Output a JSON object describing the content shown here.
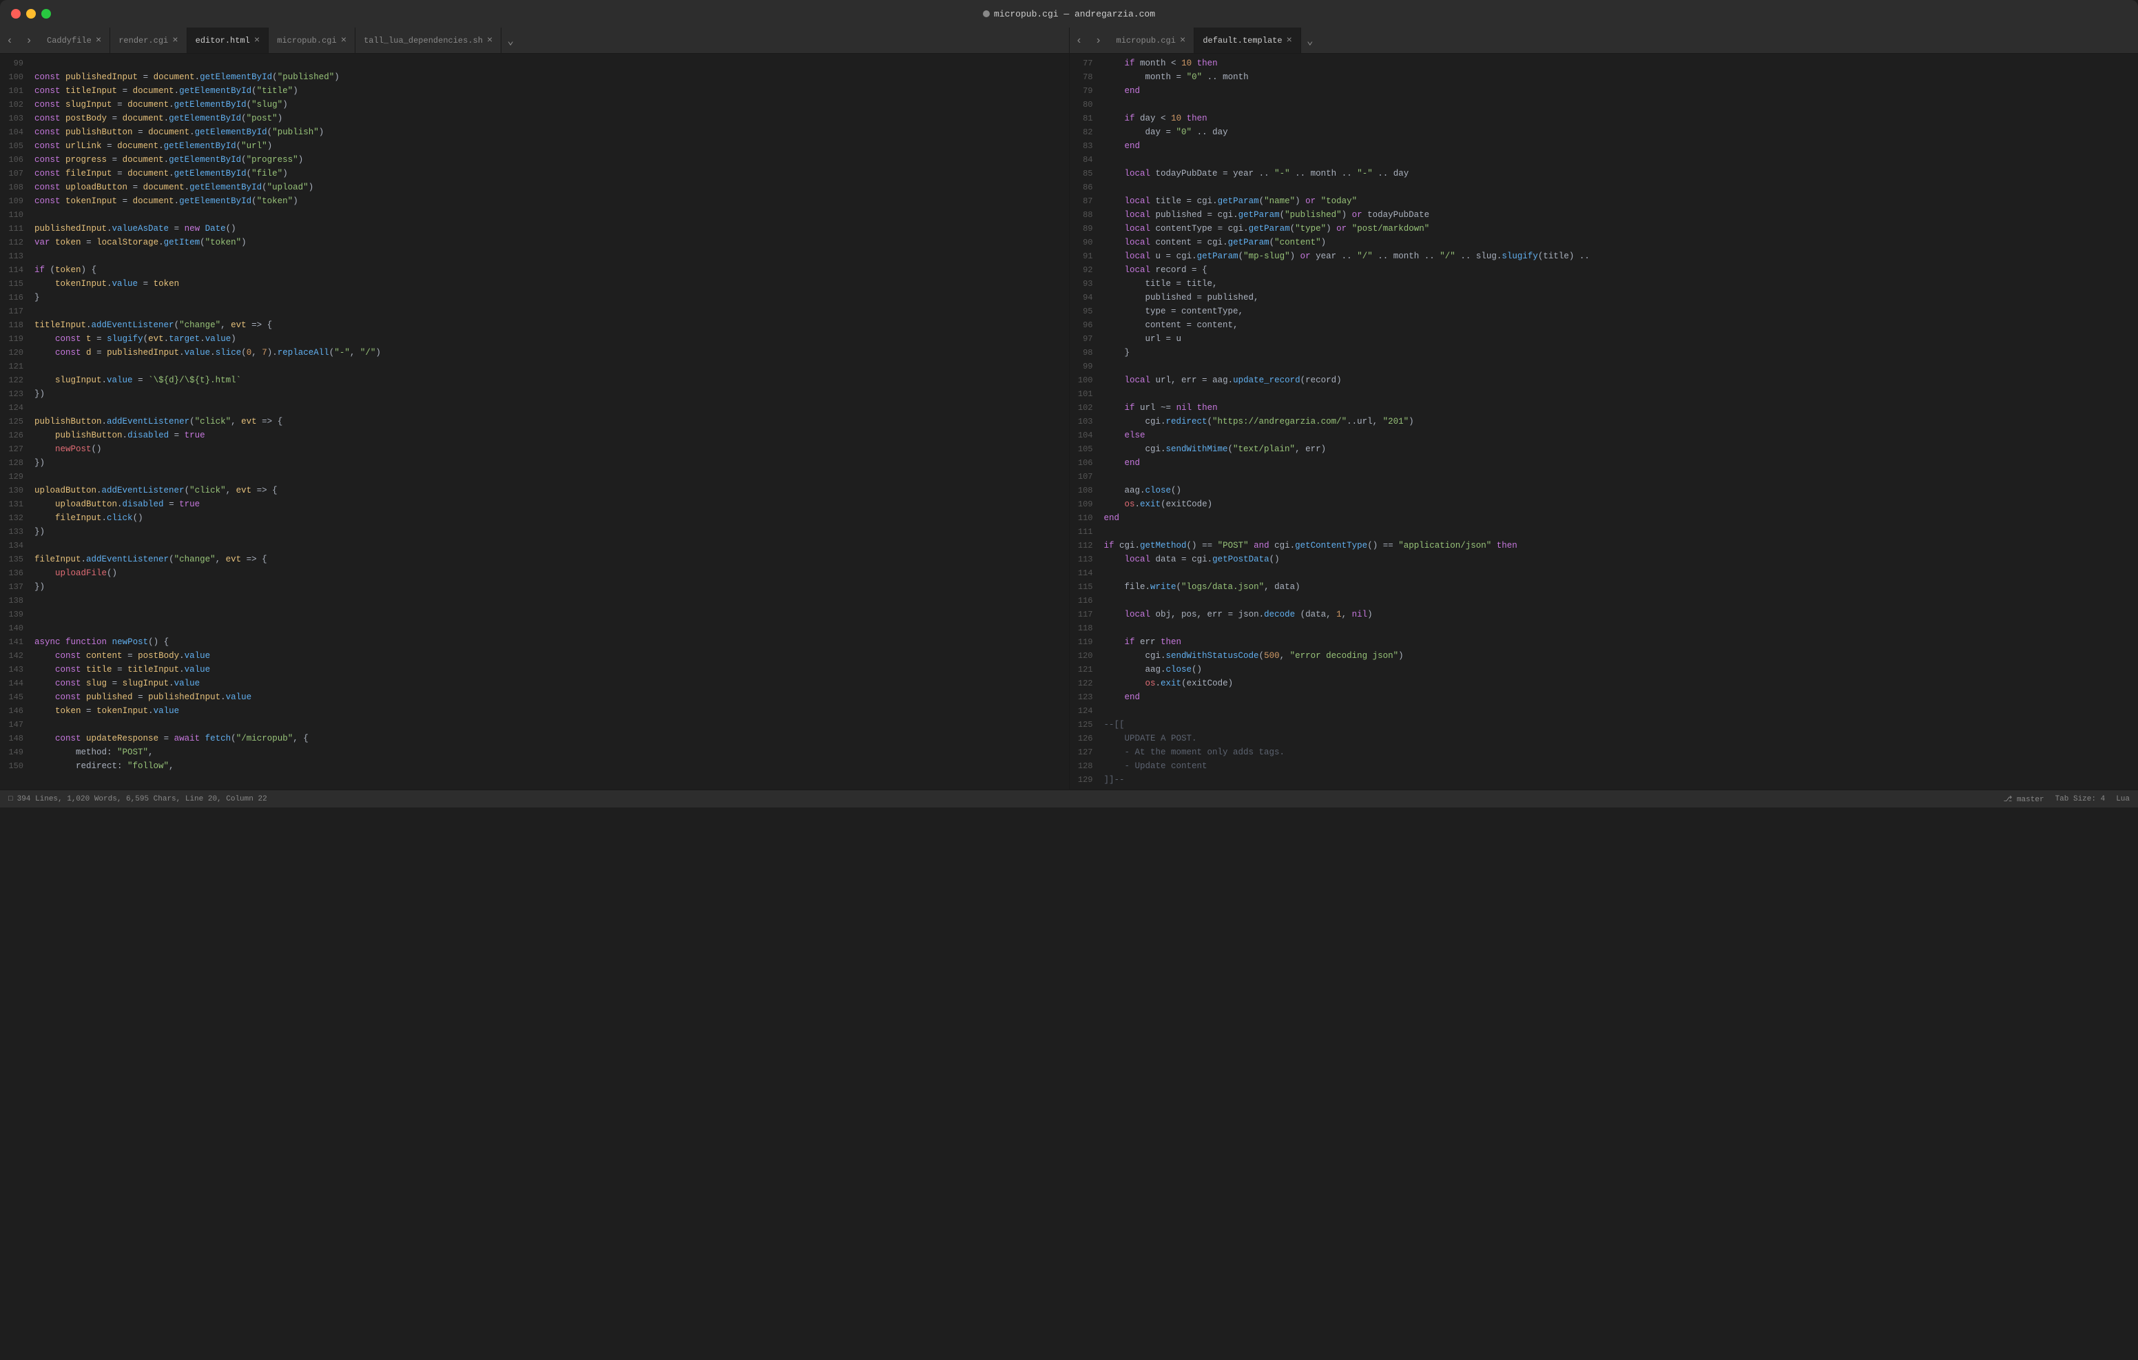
{
  "window": {
    "title": "micropub.cgi — andregarzia.com",
    "traffic_lights": [
      "close",
      "minimize",
      "maximize"
    ]
  },
  "tabs_left": {
    "items": [
      {
        "label": "Caddyfile",
        "active": false,
        "closable": true
      },
      {
        "label": "render.cgi",
        "active": false,
        "closable": true
      },
      {
        "label": "editor.html",
        "active": false,
        "closable": true
      },
      {
        "label": "micropub.cgi",
        "active": false,
        "closable": true
      },
      {
        "label": "tall_lua_dependencies.sh",
        "active": false,
        "closable": true
      }
    ]
  },
  "tabs_right": {
    "items": [
      {
        "label": "micropub.cgi",
        "active": false,
        "closable": true
      },
      {
        "label": "default.template",
        "active": false,
        "closable": true
      }
    ]
  },
  "status_bar": {
    "file_icon": "□",
    "stats": "394 Lines, 1,020 Words, 6,595 Chars, Line 20, Column 22",
    "branch_icon": "⎇",
    "branch": "master",
    "tab_size": "Tab Size: 4",
    "language": "Lua"
  },
  "left_pane": {
    "lines": [
      {
        "num": "99",
        "code": ""
      },
      {
        "num": "100",
        "code": "<kw>const</kw> <id>publishedInput</id> <op>=</op> <id>document</id>.<fn>getElementById</fn>(<str>\"published\"</str>)"
      },
      {
        "num": "101",
        "code": "<kw>const</kw> <id>titleInput</id> <op>=</op> <id>document</id>.<fn>getElementById</fn>(<str>\"title\"</str>)"
      },
      {
        "num": "102",
        "code": "<kw>const</kw> <id>slugInput</id> <op>=</op> <id>document</id>.<fn>getElementById</fn>(<str>\"slug\"</str>)"
      },
      {
        "num": "103",
        "code": "<kw>const</kw> <id>postBody</id> <op>=</op> <id>document</id>.<fn>getElementById</fn>(<str>\"post\"</str>)"
      },
      {
        "num": "104",
        "code": "<kw>const</kw> <id>publishButton</id> <op>=</op> <id>document</id>.<fn>getElementById</fn>(<str>\"publish\"</str>)"
      },
      {
        "num": "105",
        "code": "<kw>const</kw> <id>urlLink</id> <op>=</op> <id>document</id>.<fn>getElementById</fn>(<str>\"url\"</str>)"
      },
      {
        "num": "106",
        "code": "<kw>const</kw> <id>progress</id> <op>=</op> <id>document</id>.<fn>getElementById</fn>(<str>\"progress\"</str>)"
      },
      {
        "num": "107",
        "code": "<kw>const</kw> <id>fileInput</id> <op>=</op> <id>document</id>.<fn>getElementById</fn>(<str>\"file\"</str>)"
      },
      {
        "num": "108",
        "code": "<kw>const</kw> <id>uploadButton</id> <op>=</op> <id>document</id>.<fn>getElementById</fn>(<str>\"upload\"</str>)"
      },
      {
        "num": "109",
        "code": "<kw>const</kw> <id>tokenInput</id> <op>=</op> <id>document</id>.<fn>getElementById</fn>(<str>\"token\"</str>)"
      },
      {
        "num": "110",
        "code": ""
      },
      {
        "num": "111",
        "code": "<id>publishedInput</id>.<prop>valueAsDate</prop> <op>=</op> <kw>new</kw> <fn>Date</fn>()"
      },
      {
        "num": "112",
        "code": "<kw>var</kw> <id>token</id> <op>=</op> <id>localStorage</id>.<fn>getItem</fn>(<str>\"token\"</str>)"
      },
      {
        "num": "113",
        "code": ""
      },
      {
        "num": "114",
        "code": "<kw>if</kw> (<id>token</id>) <punc>{</punc>"
      },
      {
        "num": "115",
        "code": "    <id>tokenInput</id>.<prop>value</prop> <op>=</op> <id>token</id>"
      },
      {
        "num": "116",
        "code": "<punc>}</punc>"
      },
      {
        "num": "117",
        "code": ""
      },
      {
        "num": "118",
        "code": "<id>titleInput</id>.<fn>addEventListener</fn>(<str>\"change\"</str>, <id>evt</id> <op>=></op> <punc>{</punc>"
      },
      {
        "num": "119",
        "code": "    <kw>const</kw> <id>t</id> <op>=</op> <fn>slugify</fn>(<id>evt</id>.<prop>target</prop>.<prop>value</prop>)"
      },
      {
        "num": "120",
        "code": "    <kw>const</kw> <id>d</id> <op>=</op> <id>publishedInput</id>.<prop>value</prop>.<fn>slice</fn>(<num>0</num>, <num>7</num>).<fn>replaceAll</fn>(<str>\"-\"</str>, <str>\"/\"</str>)"
      },
      {
        "num": "121",
        "code": ""
      },
      {
        "num": "122",
        "code": "    <id>slugInput</id>.<prop>value</prop> <op>=</op> <str>`\\${d}/\\${t}.html`</str>"
      },
      {
        "num": "123",
        "code": "<punc>})</punc>"
      },
      {
        "num": "124",
        "code": ""
      },
      {
        "num": "125",
        "code": "<id>publishButton</id>.<fn>addEventListener</fn>(<str>\"click\"</str>, <id>evt</id> <op>=></op> <punc>{</punc>"
      },
      {
        "num": "126",
        "code": "    <id>publishButton</id>.<prop>disabled</prop> <op>=</op> <kw>true</kw>"
      },
      {
        "num": "127",
        "code": "    <red>newPost</red>()"
      },
      {
        "num": "128",
        "code": "<punc>})</punc>"
      },
      {
        "num": "129",
        "code": ""
      },
      {
        "num": "130",
        "code": "<id>uploadButton</id>.<fn>addEventListener</fn>(<str>\"click\"</str>, <id>evt</id> <op>=></op> <punc>{</punc>"
      },
      {
        "num": "131",
        "code": "    <id>uploadButton</id>.<prop>disabled</prop> <op>=</op> <kw>true</kw>"
      },
      {
        "num": "132",
        "code": "    <id>fileInput</id>.<fn>click</fn>()"
      },
      {
        "num": "133",
        "code": "<punc>})</punc>"
      },
      {
        "num": "134",
        "code": ""
      },
      {
        "num": "135",
        "code": "<id>fileInput</id>.<fn>addEventListener</fn>(<str>\"change\"</str>, <id>evt</id> <op>=></op> <punc>{</punc>"
      },
      {
        "num": "136",
        "code": "    <red>uploadFile</red>()"
      },
      {
        "num": "137",
        "code": "<punc>})</punc>"
      },
      {
        "num": "138",
        "code": ""
      },
      {
        "num": "139",
        "code": ""
      },
      {
        "num": "140",
        "code": ""
      },
      {
        "num": "141",
        "code": "<kw>async</kw> <kw>function</kw> <fn>newPost</fn>() <punc>{</punc>"
      },
      {
        "num": "142",
        "code": "    <kw>const</kw> <id>content</id> <op>=</op> <id>postBody</id>.<prop>value</prop>"
      },
      {
        "num": "143",
        "code": "    <kw>const</kw> <id>title</id> <op>=</op> <id>titleInput</id>.<prop>value</prop>"
      },
      {
        "num": "144",
        "code": "    <kw>const</kw> <id>slug</id> <op>=</op> <id>slugInput</id>.<prop>value</prop>"
      },
      {
        "num": "145",
        "code": "    <kw>const</kw> <id>published</id> <op>=</op> <id>publishedInput</id>.<prop>value</prop>"
      },
      {
        "num": "146",
        "code": "    <id>token</id> <op>=</op> <id>tokenInput</id>.<prop>value</prop>"
      },
      {
        "num": "147",
        "code": ""
      },
      {
        "num": "148",
        "code": "    <kw>const</kw> <id>updateResponse</id> <op>=</op> <kw>await</kw> <fn>fetch</fn>(<str>\"/micropub\"</str>, <punc>{</punc>"
      },
      {
        "num": "149",
        "code": "        method: <str>\"POST\"</str>,"
      },
      {
        "num": "150",
        "code": "        redirect: <str>\"follow\"</str>,"
      }
    ]
  },
  "right_pane": {
    "lines": [
      {
        "num": "77",
        "code": "    <kw>if</kw> month <op>&lt;</op> <num>10</num> <kw>then</kw>"
      },
      {
        "num": "78",
        "code": "        month <op>=</op> <str>\"0\"</str> <op>..</op> month"
      },
      {
        "num": "79",
        "code": "    <kw>end</kw>"
      },
      {
        "num": "80",
        "code": ""
      },
      {
        "num": "81",
        "code": "    <kw>if</kw> day <op>&lt;</op> <num>10</num> <kw>then</kw>"
      },
      {
        "num": "82",
        "code": "        day <op>=</op> <str>\"0\"</str> <op>..</op> day"
      },
      {
        "num": "83",
        "code": "    <kw>end</kw>"
      },
      {
        "num": "84",
        "code": ""
      },
      {
        "num": "85",
        "code": "    <kw>local</kw> todayPubDate <op>=</op> year <op>..</op> <str>\"-\"</str> <op>..</op> month <op>..</op> <str>\"-\"</str> <op>..</op> day"
      },
      {
        "num": "86",
        "code": ""
      },
      {
        "num": "87",
        "code": "    <kw>local</kw> title <op>=</op> cgi.<fn>getParam</fn>(<str>\"name\"</str>) <kw>or</kw> <str>\"today\"</str>"
      },
      {
        "num": "88",
        "code": "    <kw>local</kw> published <op>=</op> cgi.<fn>getParam</fn>(<str>\"published\"</str>) <kw>or</kw> todayPubDate"
      },
      {
        "num": "89",
        "code": "    <kw>local</kw> contentType <op>=</op> cgi.<fn>getParam</fn>(<str>\"type\"</str>) <kw>or</kw> <str>\"post/markdown\"</str>"
      },
      {
        "num": "90",
        "code": "    <kw>local</kw> content <op>=</op> cgi.<fn>getParam</fn>(<str>\"content\"</str>)"
      },
      {
        "num": "91",
        "code": "    <kw>local</kw> u <op>=</op> cgi.<fn>getParam</fn>(<str>\"mp-slug\"</str>) <kw>or</kw> year <op>..</op> <str>\"/\"</str> <op>..</op> month <op>..</op> <str>\"/\"</str> <op>..</op> slug.<fn>slugify</fn>(title) <op>..</op>"
      },
      {
        "num": "92",
        "code": "    <kw>local</kw> record <op>=</op> <punc>{</punc>"
      },
      {
        "num": "93",
        "code": "        title <op>=</op> title,"
      },
      {
        "num": "94",
        "code": "        published <op>=</op> published,"
      },
      {
        "num": "95",
        "code": "        type <op>=</op> contentType,"
      },
      {
        "num": "96",
        "code": "        content <op>=</op> content,"
      },
      {
        "num": "97",
        "code": "        url <op>=</op> u"
      },
      {
        "num": "98",
        "code": "    <punc>}</punc>"
      },
      {
        "num": "99",
        "code": ""
      },
      {
        "num": "100",
        "code": "    <kw>local</kw> url, err <op>=</op> aag.<fn>update_record</fn>(record)"
      },
      {
        "num": "101",
        "code": ""
      },
      {
        "num": "102",
        "code": "    <kw>if</kw> url <op>~=</op> <kw>nil</kw> <kw>then</kw>"
      },
      {
        "num": "103",
        "code": "        cgi.<fn>redirect</fn>(<str>\"https://andregarzia.com/\"</str><op>..</op>url, <str>\"201\"</str>)"
      },
      {
        "num": "104",
        "code": "    <kw>else</kw>"
      },
      {
        "num": "105",
        "code": "        cgi.<fn>sendWithMime</fn>(<str>\"text/plain\"</str>, err)"
      },
      {
        "num": "106",
        "code": "    <kw>end</kw>"
      },
      {
        "num": "107",
        "code": ""
      },
      {
        "num": "108",
        "code": "    aag.<fn>close</fn>()"
      },
      {
        "num": "109",
        "code": "    <id2>os</id2>.<fn>exit</fn>(exitCode)"
      },
      {
        "num": "110",
        "code": "<kw>end</kw>"
      },
      {
        "num": "111",
        "code": ""
      },
      {
        "num": "112",
        "code": "<kw>if</kw> cgi.<fn>getMethod</fn>() <op>==</op> <str>\"POST\"</str> <kw>and</kw> cgi.<fn>getContentType</fn>() <op>==</op> <str>\"application/json\"</str> <kw>then</kw>"
      },
      {
        "num": "113",
        "code": "    <kw>local</kw> data <op>=</op> cgi.<fn>getPostData</fn>()"
      },
      {
        "num": "114",
        "code": ""
      },
      {
        "num": "115",
        "code": "    file.<fn>write</fn>(<str>\"logs/data.json\"</str>, data)"
      },
      {
        "num": "116",
        "code": ""
      },
      {
        "num": "117",
        "code": "    <kw>local</kw> obj, pos, err <op>=</op> json.<fn>decode</fn> (data, <num>1</num>, <kw>nil</kw>)"
      },
      {
        "num": "118",
        "code": ""
      },
      {
        "num": "119",
        "code": "    <kw>if</kw> err <kw>then</kw>"
      },
      {
        "num": "120",
        "code": "        cgi.<fn>sendWithStatusCode</fn>(<num>500</num>, <str>\"error decoding json\"</str>)"
      },
      {
        "num": "121",
        "code": "        aag.<fn>close</fn>()"
      },
      {
        "num": "122",
        "code": "        <id2>os</id2>.<fn>exit</fn>(exitCode)"
      },
      {
        "num": "123",
        "code": "    <kw>end</kw>"
      },
      {
        "num": "124",
        "code": ""
      },
      {
        "num": "125",
        "code": "<cm>--[[</cm>"
      },
      {
        "num": "126",
        "code": "<cm>    UPDATE A POST.</cm>"
      },
      {
        "num": "127",
        "code": "<cm>    - At the moment only adds tags.</cm>"
      },
      {
        "num": "128",
        "code": "<cm>    - Update content</cm>"
      },
      {
        "num": "129",
        "code": "<cm>]]--</cm>"
      }
    ]
  }
}
